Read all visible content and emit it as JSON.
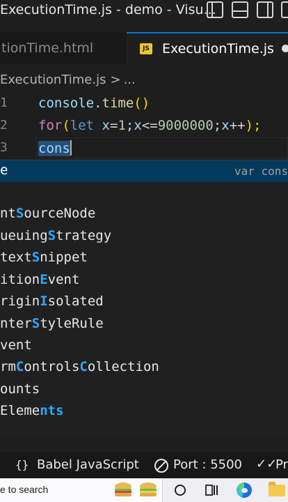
{
  "window": {
    "title": "ExecutionTime.js - demo - Visu..."
  },
  "tabs": [
    {
      "label": "tionTime.html",
      "active": false
    },
    {
      "label": "ExecutionTime.js",
      "icon": "JS",
      "active": true,
      "dirty": true
    }
  ],
  "breadcrumb": {
    "file": "ExecutionTime.js",
    "separator": ">",
    "more": "..."
  },
  "editor": {
    "lines": [
      {
        "number": "1",
        "tokens": [
          "console",
          ".",
          "time",
          "()"
        ]
      },
      {
        "number": "2",
        "tokens": [
          "for",
          "(",
          "let",
          " x",
          "=",
          "1",
          ";",
          "x",
          "<=",
          "9000000",
          ";",
          "x",
          "++",
          ");"
        ]
      },
      {
        "number": "3",
        "tokens": [
          "cons"
        ]
      }
    ]
  },
  "suggest": {
    "selected": {
      "prefix": "",
      "match": "",
      "rest": "e",
      "detail": "var cons"
    },
    "items": [
      {
        "a": "nt",
        "b": "S",
        "c": "ourceNode"
      },
      {
        "a": "ueuing",
        "b": "S",
        "c": "trategy"
      },
      {
        "a": "text",
        "b": "S",
        "c": "nippet"
      },
      {
        "a": "ition",
        "b": "E",
        "c": "vent"
      },
      {
        "a": "rigin",
        "b": "I",
        "c": "solated"
      },
      {
        "a": "nter",
        "b": "S",
        "c": "tyleRule"
      },
      {
        "a": "vent",
        "b": "",
        "c": ""
      },
      {
        "a": "rm",
        "b": "C",
        "c": "ontrols",
        "d": "C",
        "e": "ollection"
      },
      {
        "a": "ounts",
        "b": "",
        "c": ""
      },
      {
        "a": "Eleme",
        "b": "nts",
        "c": ""
      }
    ]
  },
  "statusbar": {
    "braces": "{}",
    "language": "Babel JavaScript",
    "port": "Port : 5500",
    "prettier": "Pr"
  },
  "taskbar": {
    "search_placeholder": "e to search"
  },
  "colors": {
    "accent": "#0078d4",
    "selection": "#04395e",
    "match": "#2aaaff"
  }
}
